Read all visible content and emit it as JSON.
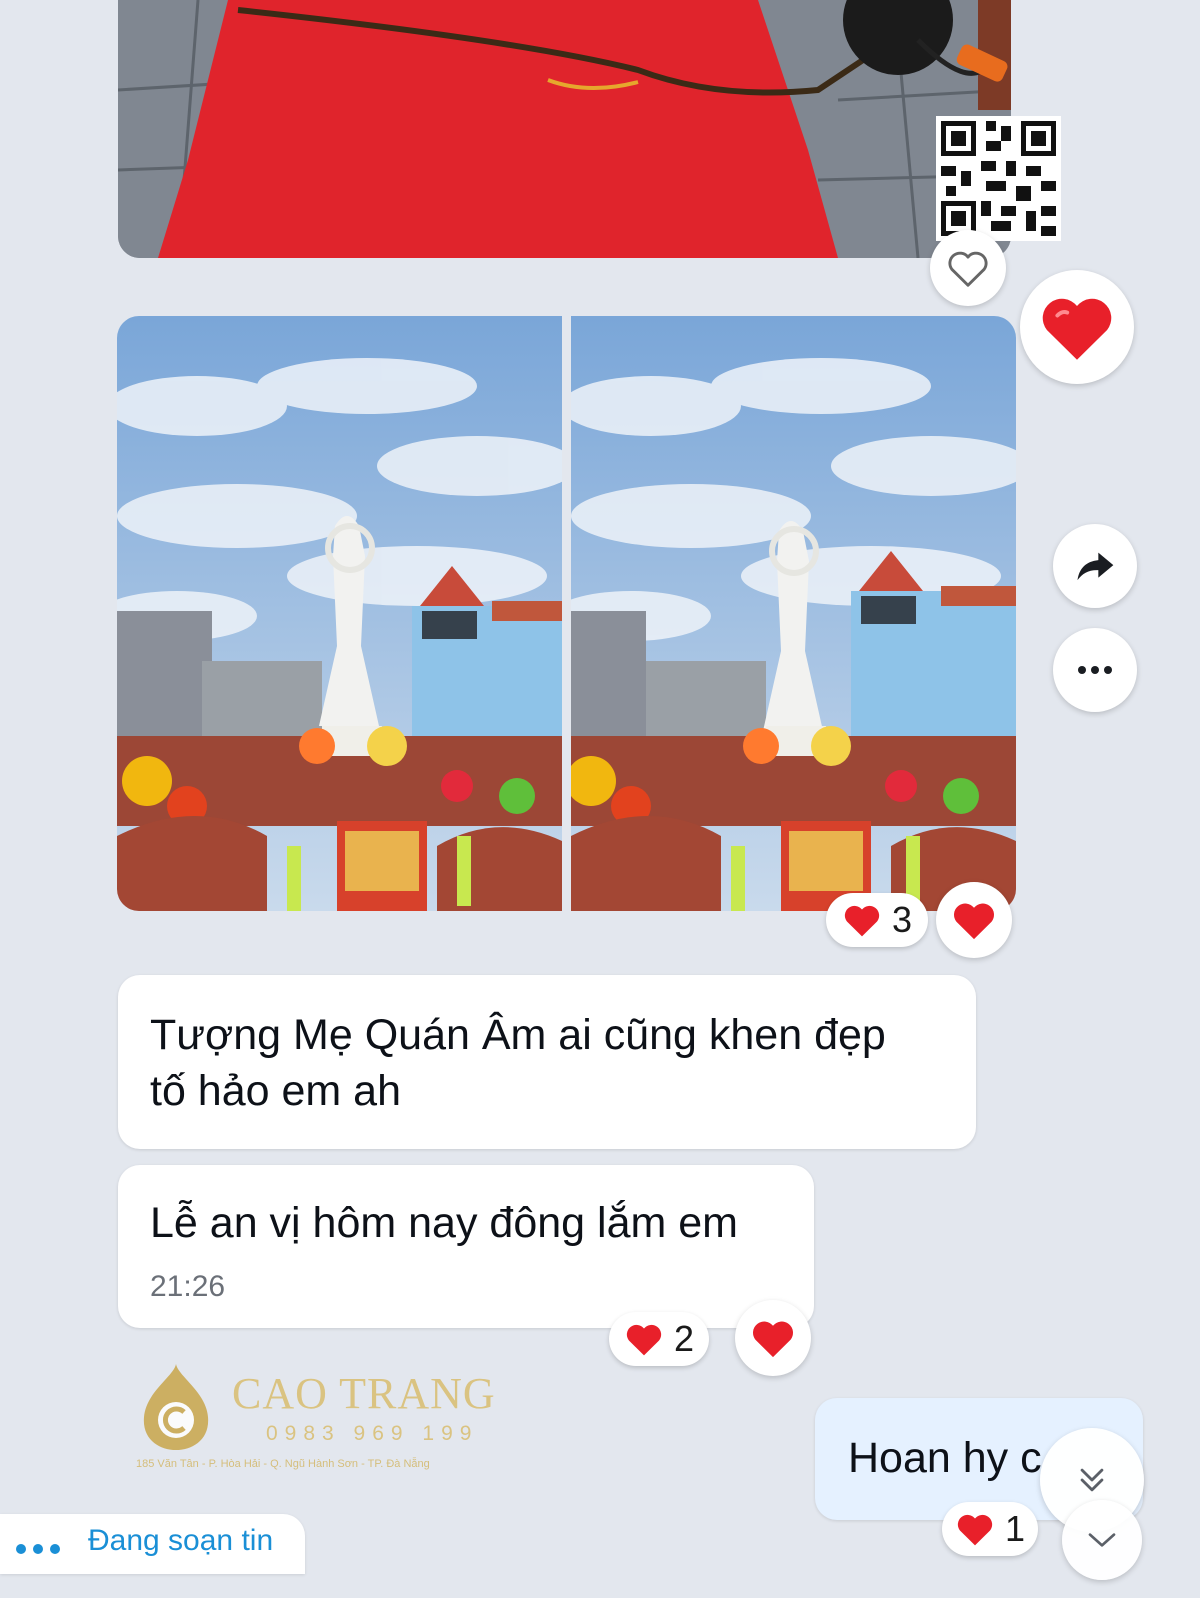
{
  "messages": [
    {
      "text": "Tượng Mẹ Quán Âm ai cũng khen đẹp\ntố hảo em ah"
    },
    {
      "text": "Lễ an vị hôm nay đông lắm em",
      "time": "21:26"
    }
  ],
  "sent_message": {
    "text": "Hoan hy c"
  },
  "reactions": {
    "photos_count": "3",
    "message_count": "2",
    "sent_count": "1"
  },
  "typing_indicator": {
    "text": "Đang soạn tin"
  },
  "watermark": {
    "brand": "CAO TRANG",
    "phone": "0983 969 199",
    "address": "185 Văn Tân - P. Hòa Hải - Q. Ngũ Hành Sơn - TP. Đà Nẵng"
  },
  "colors": {
    "background": "#e3e7ee",
    "heart": "#e8202a",
    "sent_bubble": "#e5f1ff",
    "typing": "#1a8fd6",
    "watermark_gold": "#c9a64a"
  }
}
